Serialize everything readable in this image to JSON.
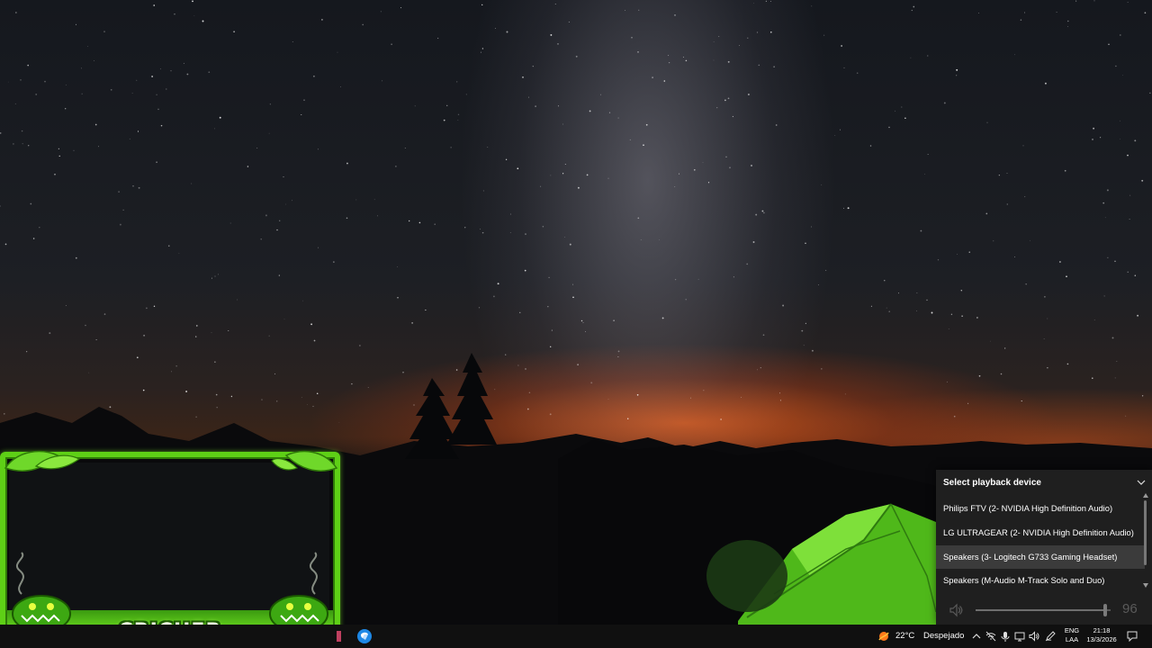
{
  "playback_flyout": {
    "title": "Select playback device",
    "devices": [
      {
        "label": "Philips FTV (2- NVIDIA High Definition Audio)"
      },
      {
        "label": "LG ULTRAGEAR (2- NVIDIA High Definition Audio)"
      },
      {
        "label": "Speakers (3- Logitech G733 Gaming Headset)"
      },
      {
        "label": "Speakers (M-Audio M-Track Solo and Duo)"
      }
    ],
    "hovered_device_index": 2,
    "volume": {
      "value_text": "96",
      "level": 0.96
    }
  },
  "overlay": {
    "label": "CRICHER",
    "accent_color": "#5ed016"
  },
  "taskbar": {
    "apps": [
      {
        "icon": "app-icon-partial"
      },
      {
        "icon": "browser-app-icon",
        "accent": "#1e88e5"
      }
    ],
    "weather": {
      "temperature": "22°C",
      "description": "Despejado",
      "icon": "weather-sun-icon"
    },
    "tray": {
      "icons": [
        "chevron-up-icon",
        "network-disconnected-icon",
        "microphone-icon",
        "display-icon",
        "speaker-icon",
        "pen-icon"
      ],
      "language_line1": "ENG",
      "language_line2": "LAA",
      "time": "21:18",
      "date": "13/3/2026"
    }
  }
}
